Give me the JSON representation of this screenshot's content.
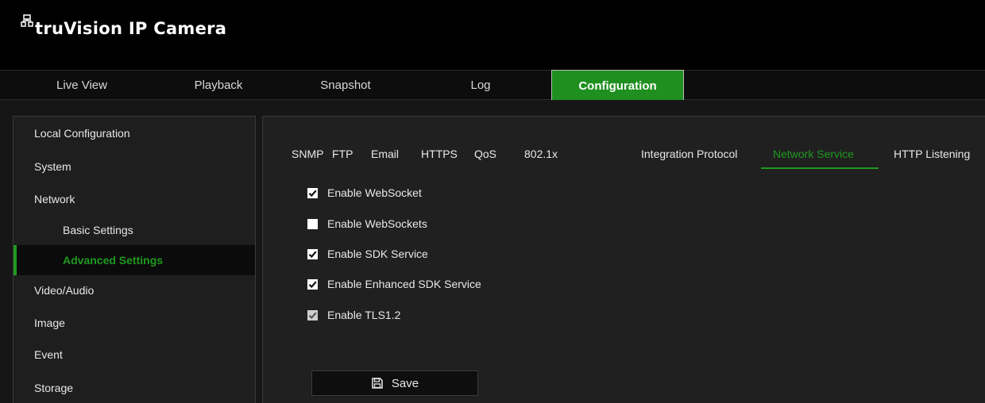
{
  "app": {
    "title": "truVision IP Camera"
  },
  "nav": {
    "items": [
      {
        "label": "Live View"
      },
      {
        "label": "Playback"
      },
      {
        "label": "Snapshot"
      },
      {
        "label": "Log"
      },
      {
        "label": "Configuration"
      }
    ],
    "active": "Configuration"
  },
  "sidebar": {
    "items": [
      {
        "label": "Local Configuration"
      },
      {
        "label": "System"
      },
      {
        "label": "Network"
      },
      {
        "label": "Basic Settings"
      },
      {
        "label": "Advanced Settings"
      },
      {
        "label": "Video/Audio"
      },
      {
        "label": "Image"
      },
      {
        "label": "Event"
      },
      {
        "label": "Storage"
      }
    ],
    "active": "Advanced Settings"
  },
  "tabs": {
    "items": [
      {
        "label": "SNMP"
      },
      {
        "label": "FTP"
      },
      {
        "label": "Email"
      },
      {
        "label": "HTTPS"
      },
      {
        "label": "QoS"
      },
      {
        "label": "802.1x"
      },
      {
        "label": "Integration Protocol"
      },
      {
        "label": "Network Service"
      },
      {
        "label": "HTTP Listening"
      }
    ],
    "active": "Network Service"
  },
  "options": [
    {
      "label": "Enable WebSocket",
      "checked": true,
      "disabled": false
    },
    {
      "label": "Enable WebSockets",
      "checked": false,
      "disabled": false
    },
    {
      "label": "Enable SDK Service",
      "checked": true,
      "disabled": false
    },
    {
      "label": "Enable Enhanced SDK Service",
      "checked": true,
      "disabled": false
    },
    {
      "label": "Enable TLS1.2",
      "checked": true,
      "disabled": true
    }
  ],
  "save": {
    "label": "Save",
    "icon": "floppy-disk-icon"
  },
  "colors": {
    "accent": "#1f9a1f",
    "header_bg": "#000000",
    "panel_bg": "#202020"
  }
}
